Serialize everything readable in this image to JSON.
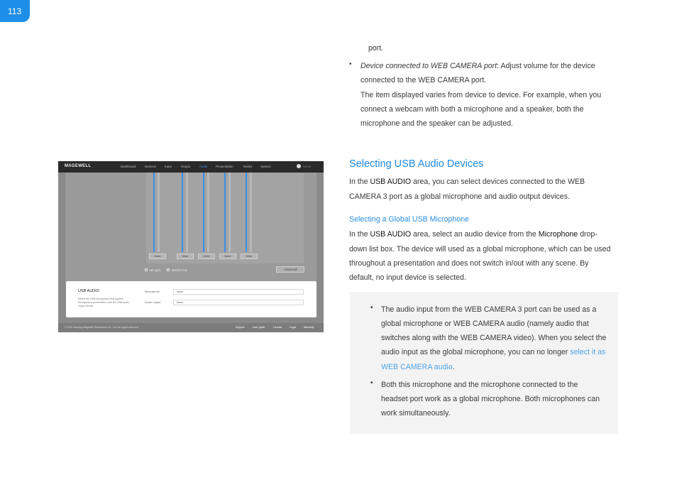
{
  "page_number": "113",
  "intro": {
    "port_line": "port.",
    "bullet_term": "Device connected to WEB CAMERA port",
    "bullet_rest": ": Adjust volume for the device",
    "line2": "connected to the WEB CAMERA port.",
    "line3": "The item displayed varies from device to device. For example, when you",
    "line4": "connect a webcam with both a microphone and a speaker, both the",
    "line5": "microphone and the speaker can be adjusted."
  },
  "section": {
    "title": "Selecting USB Audio Devices",
    "p1_a": "In the ",
    "p1_b": "USB AUDIO",
    "p1_c": " area, you can select devices connected to the WEB",
    "p1_line2": "CAMERA 3 port as a global microphone and audio output devices."
  },
  "subsection": {
    "title": "Selecting a Global USB Microphone",
    "p_a": "In the ",
    "p_b": "USB AUDIO",
    "p_c": " area, select an audio device from the ",
    "p_d": "Microphone",
    "p_e": " drop-",
    "line2": "down list box. The device will used as a global microphone, which can be used",
    "line3": "throughout a presentation and does not switch in/out with any scene. By",
    "line4": "default, no input device is selected."
  },
  "note": {
    "b1_l1": "The audio input from the WEB CAMERA 3 port can be used as a",
    "b1_l2": "global microphone or WEB CAMERA audio (namely audio that",
    "b1_l3": "switches along with the WEB CAMERA video). When you select the",
    "b1_l4a": "audio input as the global microphone, you can no longer ",
    "b1_l4b": "select it as",
    "b1_l5a": "WEB CAMERA audio",
    "b1_l5b": ".",
    "b2_l1": "Both this microphone and the microphone connected to the",
    "b2_l2": "headset port work as a global microphone. Both microphones can",
    "b2_l3": "work simultaneously.",
    "link_color": "#4ba3ea"
  },
  "screenshot": {
    "logo": "MAGEWELL",
    "nav": [
      "Dashboard",
      "General",
      "Input",
      "Output",
      "Audio",
      "Presentation",
      "Media",
      "System"
    ],
    "active_nav": "Audio",
    "user_label": "Admin",
    "mute_label": "Mute",
    "mic_gain_label": "Mic gain",
    "monitor_mix_label": "Monitor mix",
    "advanced_label": "Advanced",
    "usb_title": "USB AUDIO",
    "usb_desc": "Select the USB microphone that applies throughout a presentation and the USB audio output device.",
    "microphone_label": "Microphone",
    "audio_output_label": "Audio output",
    "microphone_value": "None",
    "audio_output_value": "None",
    "copyright": "© 2021 Nanjing Magewell Electronics Co., Ltd. All rights reserved.",
    "footer_links": [
      "Support",
      "User guide",
      "License",
      "Legal",
      "Warranty"
    ],
    "accent": "#3a8ee6"
  }
}
